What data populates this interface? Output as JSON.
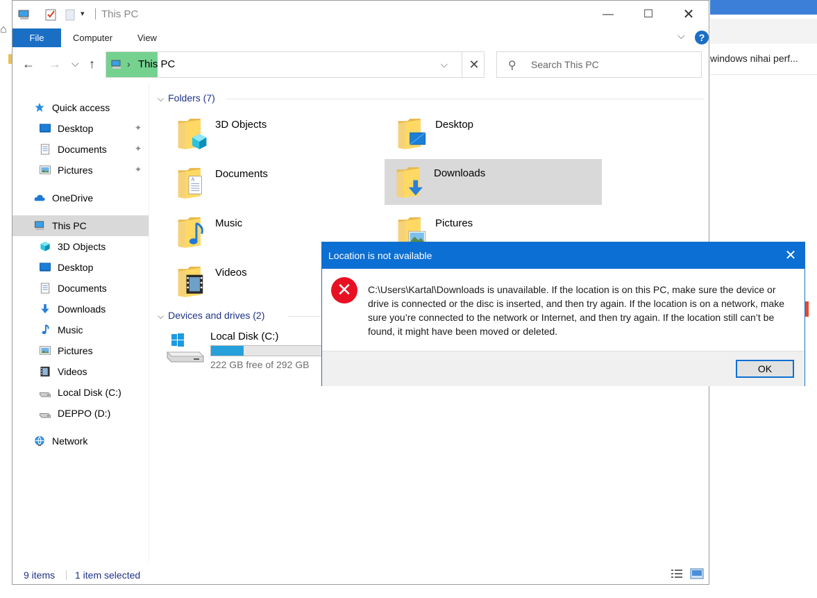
{
  "window": {
    "title": "This PC",
    "controls": {
      "minimize": "—",
      "maximize": "☐",
      "close": "✕"
    }
  },
  "ribbon": {
    "tabs": [
      "File",
      "Computer",
      "View"
    ],
    "expand_icon": "chevron-down-icon",
    "help_label": "?"
  },
  "address_bar": {
    "path": "This PC",
    "separator": "›",
    "dropdown": "⌵",
    "clear": "✕"
  },
  "search": {
    "placeholder": "Search This PC",
    "icon": "⚲"
  },
  "nav_glyphs": {
    "back": "←",
    "forward": "→",
    "recent": "⌵",
    "up": "↑"
  },
  "background_app": {
    "text": "windows nihai perf...",
    "home_icon": "⌂"
  },
  "nav_pane": {
    "pin_glyph": "✦",
    "items": [
      {
        "label": "Quick access",
        "icon": "star-icon"
      },
      {
        "label": "Desktop",
        "icon": "desktop-icon",
        "pinned": true
      },
      {
        "label": "Documents",
        "icon": "documents-icon",
        "pinned": true
      },
      {
        "label": "Pictures",
        "icon": "pictures-icon",
        "pinned": true
      },
      {
        "label": "OneDrive",
        "icon": "cloud-icon"
      },
      {
        "label": "This PC",
        "icon": "computer-icon",
        "selected": true
      },
      {
        "label": "3D Objects",
        "icon": "cube-icon"
      },
      {
        "label": "Desktop",
        "icon": "desktop-icon"
      },
      {
        "label": "Documents",
        "icon": "documents-icon"
      },
      {
        "label": "Downloads",
        "icon": "download-icon"
      },
      {
        "label": "Music",
        "icon": "music-icon"
      },
      {
        "label": "Pictures",
        "icon": "pictures-icon"
      },
      {
        "label": "Videos",
        "icon": "film-icon"
      },
      {
        "label": "Local Disk (C:)",
        "icon": "drive-icon"
      },
      {
        "label": "DEPPO (D:)",
        "icon": "drive-icon"
      },
      {
        "label": "Network",
        "icon": "network-icon"
      }
    ]
  },
  "content": {
    "folders_header": "Folders (7)",
    "folders": [
      {
        "label": "3D Objects",
        "overlay": "cube"
      },
      {
        "label": "Desktop",
        "overlay": "desktop"
      },
      {
        "label": "Documents",
        "overlay": "document"
      },
      {
        "label": "Downloads",
        "overlay": "download",
        "selected": true
      },
      {
        "label": "Music",
        "overlay": "music"
      },
      {
        "label": "Pictures",
        "overlay": "picture"
      },
      {
        "label": "Videos",
        "overlay": "film"
      }
    ],
    "drives_header": "Devices and drives (2)",
    "drive": {
      "name": "Local Disk (C:)",
      "free_text": "222 GB free of 292 GB",
      "used_fraction": 0.24
    }
  },
  "status_bar": {
    "item_count": "9 items",
    "selection": "1 item selected"
  },
  "dialog": {
    "title": "Location is not available",
    "close": "✕",
    "message": "C:\\Users\\Kartal\\Downloads is unavailable. If the location is on this PC, make sure the device or drive is connected or the disc is inserted, and then try again. If the location is on a network, make sure you’re connected to the network or Internet, and then try again. If the location still can’t be found, it might have been moved or deleted.",
    "error_glyph": "✕",
    "ok_label": "OK"
  },
  "colors": {
    "accent": "#1a6fc4",
    "dialog_title": "#0b6fd3",
    "error_red": "#e81123",
    "selection": "#d9d9d9",
    "address_highlight": "#74d18e",
    "drive_fill": "#26a0da"
  }
}
